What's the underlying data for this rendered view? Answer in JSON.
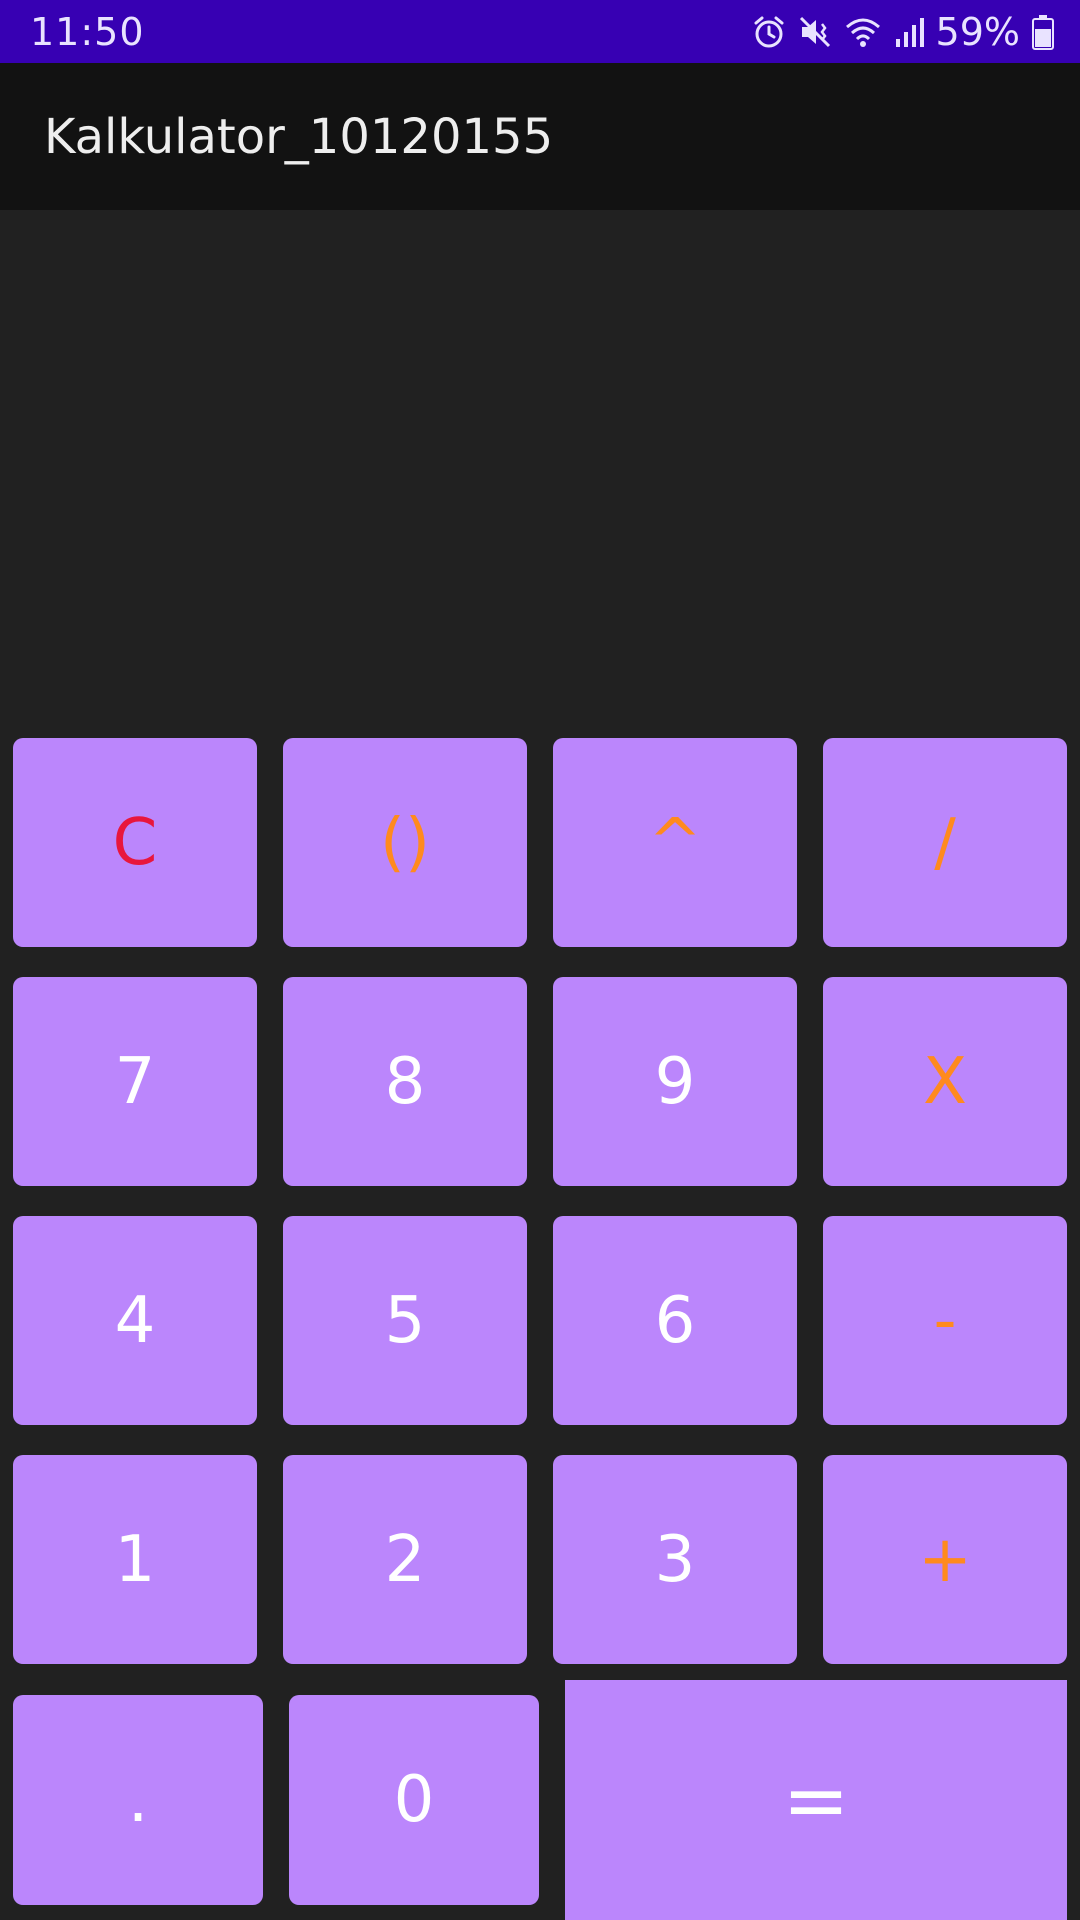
{
  "status_bar": {
    "time": "11:50",
    "battery": "59%",
    "icons": [
      "alarm-icon",
      "mute-vibrate-icon",
      "wifi-icon",
      "signal-icon",
      "battery-icon"
    ]
  },
  "app_bar": {
    "title": "Kalkulator_10120155"
  },
  "display": {
    "value": ""
  },
  "keypad": {
    "rows": [
      [
        "C",
        "()",
        "^",
        "/"
      ],
      [
        "7",
        "8",
        "9",
        "X"
      ],
      [
        "4",
        "5",
        "6",
        "-"
      ],
      [
        "1",
        "2",
        "3",
        "+"
      ],
      [
        ".",
        "0",
        "="
      ]
    ]
  },
  "colors": {
    "status_bar": "#3700B3",
    "app_bar": "#121212",
    "background": "#212121",
    "key": "#BB86FC",
    "digit_text": "#FFFFFF",
    "operator_text": "#FF8A1E",
    "clear_text": "#E8163C"
  }
}
